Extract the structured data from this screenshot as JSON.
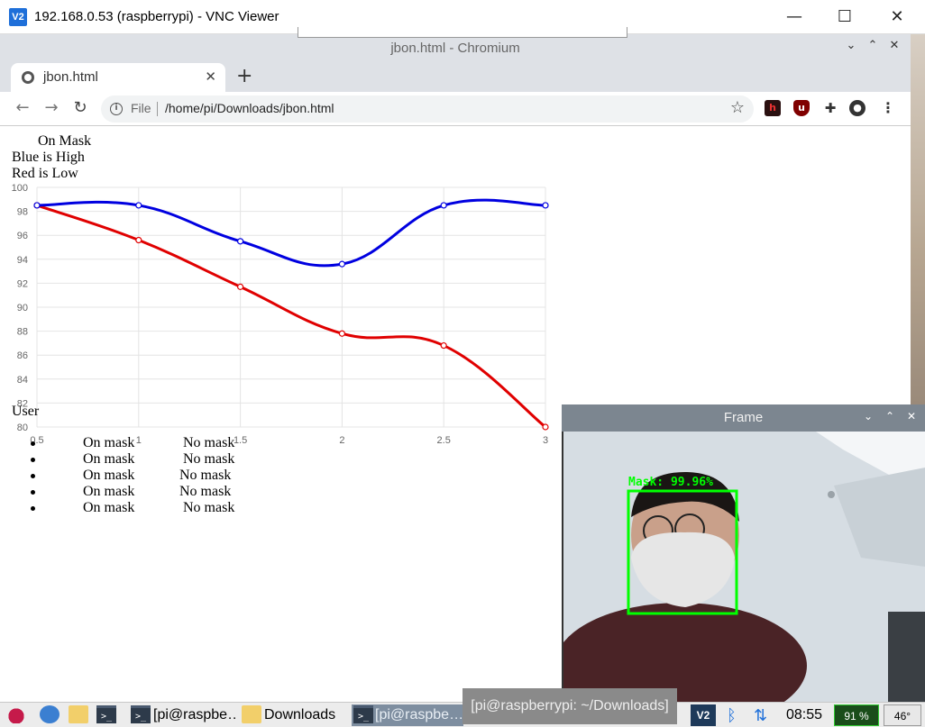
{
  "vnc": {
    "logo": "V2",
    "title": "192.168.0.53 (raspberrypi) - VNC Viewer",
    "minimize": "—",
    "maximize": "☐",
    "close": "✕"
  },
  "browser": {
    "window_title": "jbon.html - Chromium",
    "tab_title": "jbon.html",
    "url_scheme_label": "File",
    "url": "/home/pi/Downloads/jbon.html"
  },
  "page": {
    "title_line": "On Mask",
    "legend_high": "Blue is High",
    "legend_low": "Red is Low",
    "user_heading": "User",
    "rows": [
      {
        "on": "On mask",
        "no": "No mask"
      },
      {
        "on": "On mask",
        "no": "No mask"
      },
      {
        "on": "On mask",
        "no": "No mask"
      },
      {
        "on": "On mask",
        "no": "No mask"
      },
      {
        "on": "On mask",
        "no": "No mask"
      }
    ]
  },
  "chart_data": {
    "type": "line",
    "x": [
      0.5,
      1,
      1.5,
      2,
      2.5,
      3
    ],
    "x_ticks": [
      "0.5",
      "1",
      "1.5",
      "2",
      "2.5",
      "3"
    ],
    "ylim": [
      80,
      100
    ],
    "y_ticks": [
      "100",
      "98",
      "96",
      "94",
      "92",
      "90",
      "88",
      "86",
      "84",
      "82",
      "80"
    ],
    "grid": true,
    "series": [
      {
        "color": "#0000e0",
        "values": [
          98.5,
          98.5,
          95.5,
          93.6,
          98.5,
          98.5
        ]
      },
      {
        "color": "#e00000",
        "values": [
          98.5,
          95.6,
          91.7,
          87.8,
          86.8,
          80.0
        ]
      }
    ]
  },
  "frame": {
    "title": "Frame",
    "detection_label": "Mask: 99.96%",
    "box_color": "#00ff00"
  },
  "taskbar": {
    "task_terminal_1": "[pi@raspbe…",
    "task_downloads": "Downloads",
    "task_terminal_2": "[pi@raspbe…",
    "tooltip": "[pi@raspberrypi: ~/Downloads]",
    "vnc_tray": "V2",
    "clock": "08:55",
    "cpu": "91 %",
    "temp": "46°"
  }
}
